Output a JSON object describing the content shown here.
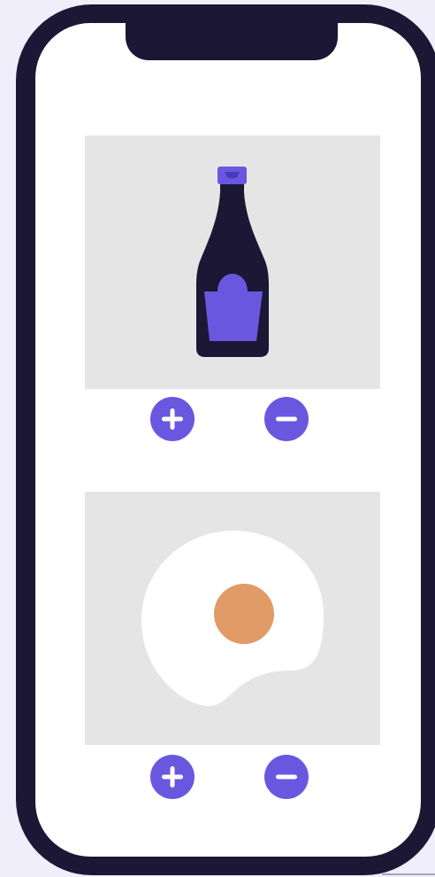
{
  "colors": {
    "page_background": "#f0eefb",
    "phone_frame": "#1b1735",
    "screen": "#ffffff",
    "card_background": "#e5e5e5",
    "accent": "#6a57e0",
    "bottle_body": "#1b1735",
    "egg_white": "#ffffff",
    "egg_yolk": "#e09b66"
  },
  "items": [
    {
      "illustration": "sauce-bottle-icon",
      "increase_icon": "plus-icon",
      "decrease_icon": "minus-icon"
    },
    {
      "illustration": "fried-egg-icon",
      "increase_icon": "plus-icon",
      "decrease_icon": "minus-icon"
    }
  ]
}
